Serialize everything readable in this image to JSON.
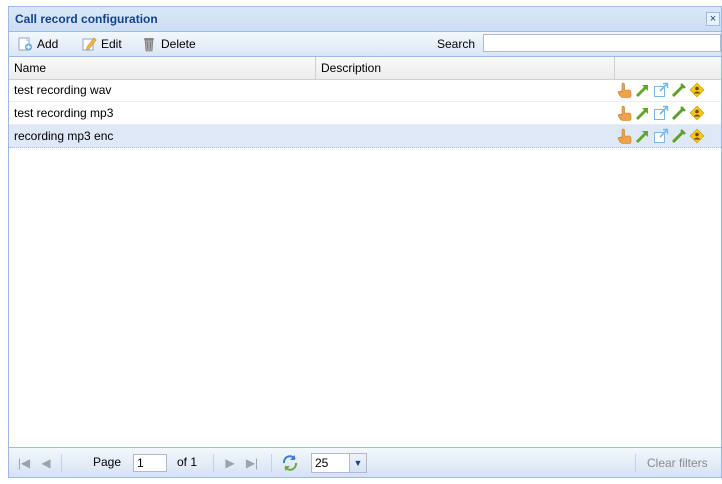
{
  "window": {
    "title": "Call record configuration",
    "close_glyph": "×"
  },
  "toolbar": {
    "add_label": "Add",
    "edit_label": "Edit",
    "delete_label": "Delete",
    "search_label": "Search",
    "search_value": ""
  },
  "grid": {
    "columns": [
      "Name",
      "Description",
      ""
    ],
    "rows": [
      {
        "name": "test recording wav",
        "description": "",
        "selected": false
      },
      {
        "name": "test recording mp3",
        "description": "",
        "selected": false
      },
      {
        "name": "recording mp3 enc",
        "description": "",
        "selected": true
      }
    ],
    "row_action_icons": [
      "hand-pointer-icon",
      "green-arrow-icon",
      "open-external-icon",
      "green-check-icon",
      "warning-user-icon"
    ]
  },
  "pager": {
    "page_label": "Page",
    "page_value": "1",
    "of_label": "of 1",
    "page_size": "25",
    "clear_filters": "Clear filters"
  },
  "colors": {
    "title_text": "#15428b",
    "border": "#99bbe8",
    "selected_row": "#dfe8f6"
  }
}
